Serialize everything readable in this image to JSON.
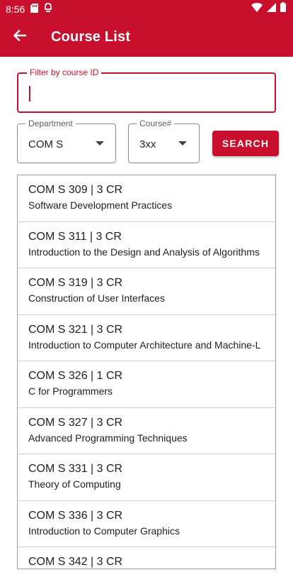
{
  "status_bar": {
    "time": "8:56",
    "left_icons": [
      "sd-card-icon",
      "notification-icon"
    ],
    "right_icons": [
      "wifi-icon",
      "cellular-icon",
      "battery-icon"
    ]
  },
  "app_bar": {
    "title": "Course List",
    "back_icon": "arrow-back-icon",
    "color": "#c8102e"
  },
  "filter": {
    "label": "Filter by course ID",
    "value": ""
  },
  "department_dropdown": {
    "label": "Department",
    "value": "COM S"
  },
  "course_number_dropdown": {
    "label": "Course#",
    "value": "3xx"
  },
  "search_button": {
    "label": "SEARCH"
  },
  "courses": [
    {
      "code": "COM S 309 | 3 CR",
      "name": "Software Development Practices"
    },
    {
      "code": "COM S 311 | 3 CR",
      "name": "Introduction to the Design and Analysis of Algorithms"
    },
    {
      "code": "COM S 319 | 3 CR",
      "name": "Construction of User Interfaces"
    },
    {
      "code": "COM S 321 | 3 CR",
      "name": "Introduction to Computer Architecture and Machine-L"
    },
    {
      "code": "COM S 326 | 1 CR",
      "name": "C for Programmers"
    },
    {
      "code": "COM S 327 | 3 CR",
      "name": "Advanced Programming Techniques"
    },
    {
      "code": "COM S 331 | 3 CR",
      "name": "Theory of Computing"
    },
    {
      "code": "COM S 336 | 3 CR",
      "name": "Introduction to Computer Graphics"
    },
    {
      "code": "COM S 342 | 3 CR",
      "name": ""
    }
  ]
}
